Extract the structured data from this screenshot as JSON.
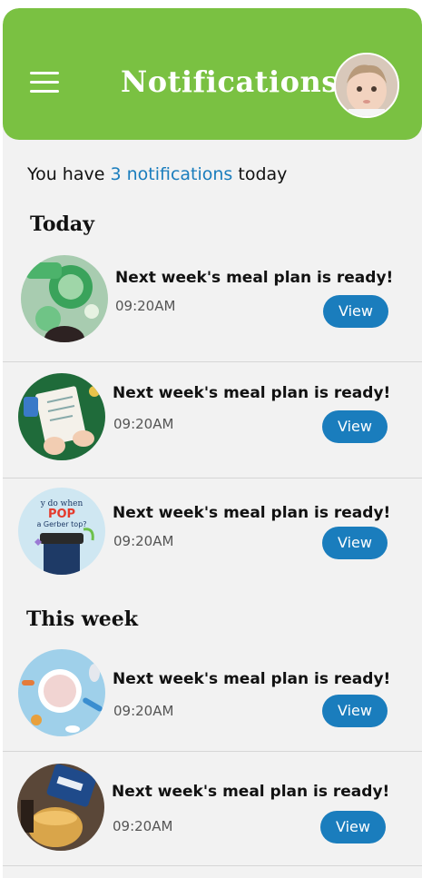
{
  "header": {
    "title": "Notifications",
    "menu_icon": "hamburger-menu-icon",
    "avatar_icon": "baby-avatar",
    "color": "#7ac142"
  },
  "summary": {
    "prefix": "You have ",
    "highlight": "3 notifications",
    "suffix": " today",
    "highlight_color": "#1a7dbd"
  },
  "sections": {
    "today": "Today",
    "this_week": "This week"
  },
  "notifications": [
    {
      "title": "Next week's meal plan is ready!",
      "time": "09:20AM",
      "action": "View"
    },
    {
      "title": "Next week's meal plan is ready!",
      "time": "09:20AM",
      "action": "View"
    },
    {
      "title": "Next week's meal plan is ready!",
      "time": "09:20AM",
      "action": "View"
    },
    {
      "title": "Next week's meal plan is ready!",
      "time": "09:20AM",
      "action": "View"
    },
    {
      "title": "Next week's meal plan is ready!",
      "time": "09:20AM",
      "action": "View"
    }
  ],
  "thumb3_text": {
    "line1": "y do when",
    "line2": "POP",
    "line3": "a Gerber top?"
  },
  "colors": {
    "button": "#1a7dbd",
    "background": "#f2f2f2"
  }
}
